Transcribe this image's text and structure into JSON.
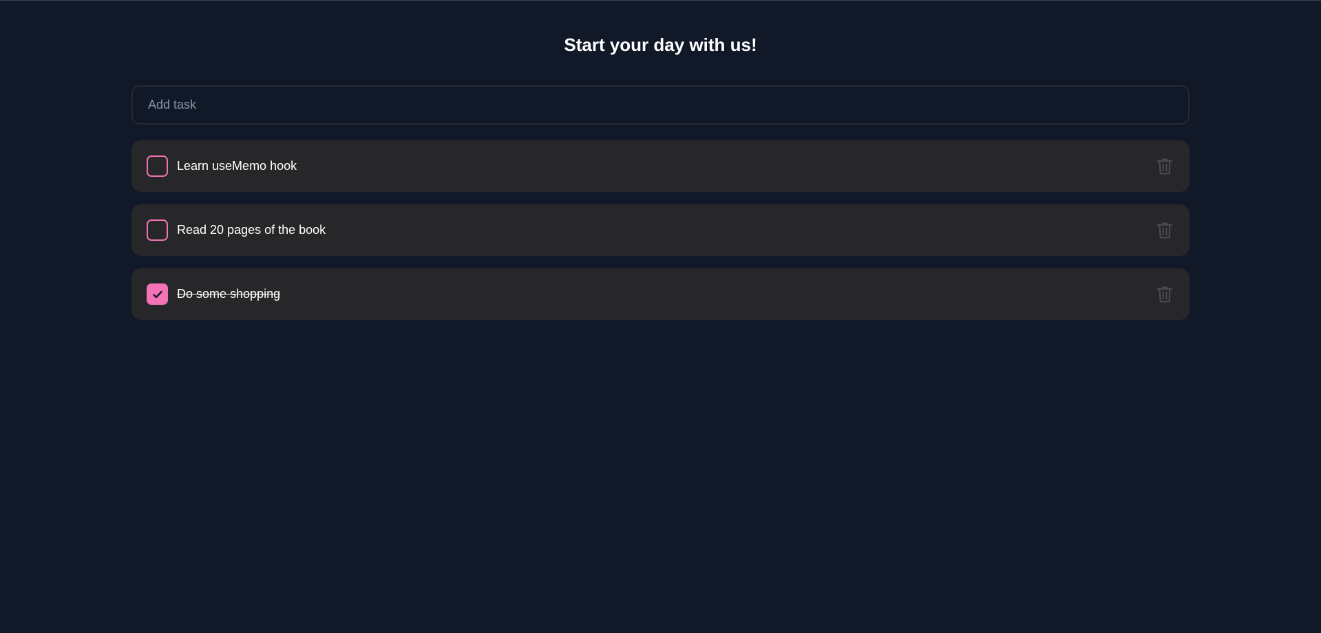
{
  "header": {
    "title": "Start your day with us!"
  },
  "add_task": {
    "placeholder": "Add task",
    "value": ""
  },
  "tasks": [
    {
      "label": "Learn useMemo hook",
      "completed": false
    },
    {
      "label": "Read 20 pages of the book",
      "completed": false
    },
    {
      "label": "Do some shopping",
      "completed": true
    }
  ],
  "icons": {
    "checkbox": "checkbox",
    "check": "check-icon",
    "delete": "trash-icon"
  },
  "colors": {
    "background": "#111827",
    "card": "#27272a",
    "accent": "#f472b6",
    "muted_icon": "#4b4f58",
    "placeholder": "#8b93a3"
  }
}
